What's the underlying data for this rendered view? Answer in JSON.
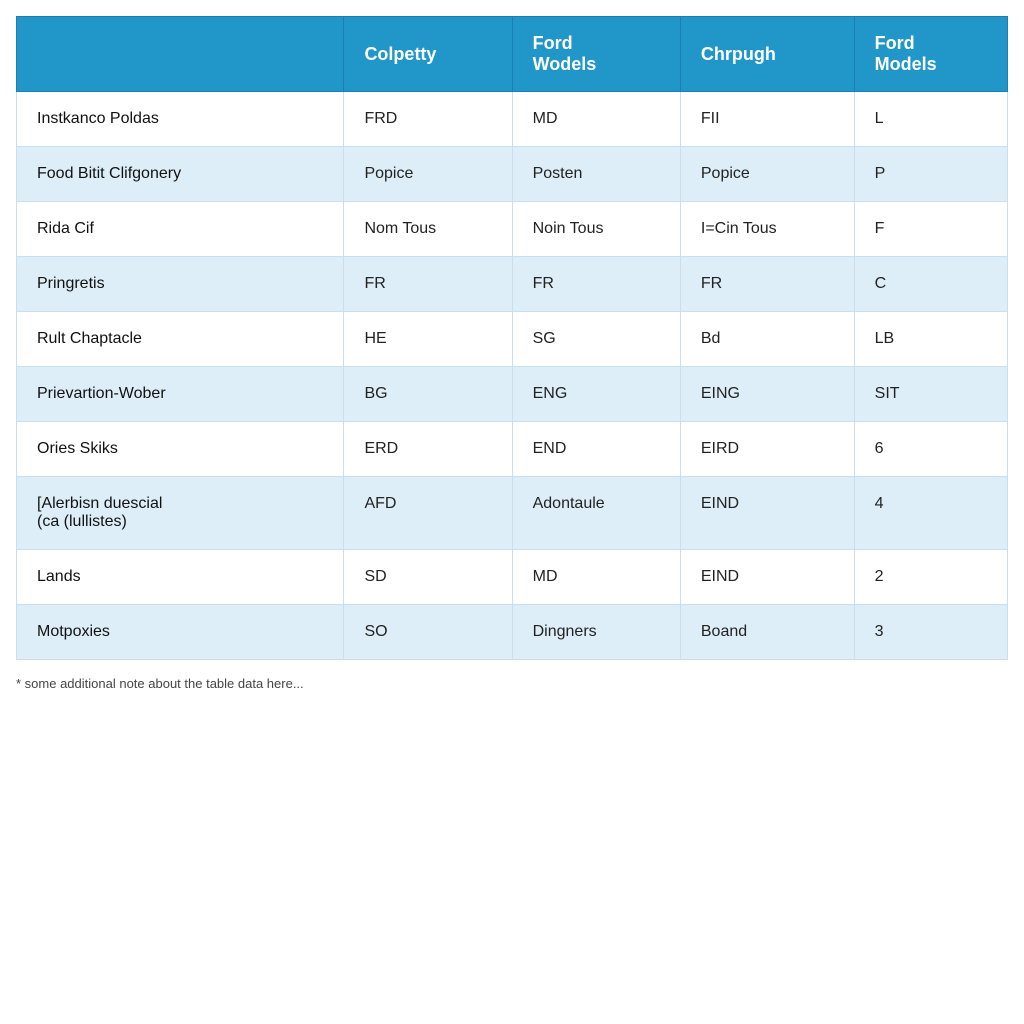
{
  "table": {
    "headers": [
      {
        "id": "col-name",
        "label": ""
      },
      {
        "id": "col-colpetty",
        "label": "Colpetty"
      },
      {
        "id": "col-ford-wodels",
        "label": "Ford\nWodels"
      },
      {
        "id": "col-chrpugh",
        "label": "Chrpugh"
      },
      {
        "id": "col-ford-models",
        "label": "Ford\nModels"
      }
    ],
    "rows": [
      {
        "name": "Instkanco Poldas",
        "colpetty": "FRD",
        "ford_wodels": "MD",
        "chrpugh": "FII",
        "ford_models": "L"
      },
      {
        "name": "Food Bitit Clifgonery",
        "colpetty": "Popice",
        "ford_wodels": "Posten",
        "chrpugh": "Popice",
        "ford_models": "P"
      },
      {
        "name": "Rida Cif",
        "colpetty": "Nom Tous",
        "ford_wodels": "Noin Tous",
        "chrpugh": "I=Cin Tous",
        "ford_models": "F"
      },
      {
        "name": "Pringretis",
        "colpetty": "FR",
        "ford_wodels": "FR",
        "chrpugh": "FR",
        "ford_models": "C"
      },
      {
        "name": "Rult Chaptacle",
        "colpetty": "HE",
        "ford_wodels": "SG",
        "chrpugh": "Bd",
        "ford_models": "LB"
      },
      {
        "name": "Prievartion-Wober",
        "colpetty": "BG",
        "ford_wodels": "ENG",
        "chrpugh": "EING",
        "ford_models": "SIT"
      },
      {
        "name": "Ories Skiks",
        "colpetty": "ERD",
        "ford_wodels": "END",
        "chrpugh": "EIRD",
        "ford_models": "6"
      },
      {
        "name": "[Alerbisn duescial\n(ca (lullistes)",
        "colpetty": "AFD",
        "ford_wodels": "Adontaule",
        "chrpugh": "EIND",
        "ford_models": "4"
      },
      {
        "name": "Lands",
        "colpetty": "SD",
        "ford_wodels": "MD",
        "chrpugh": "EIND",
        "ford_models": "2"
      },
      {
        "name": "Motpoxies",
        "colpetty": "SO",
        "ford_wodels": "Dingners",
        "chrpugh": "Boand",
        "ford_models": "3"
      }
    ],
    "footer_note": "* some additional note about the table data here..."
  }
}
